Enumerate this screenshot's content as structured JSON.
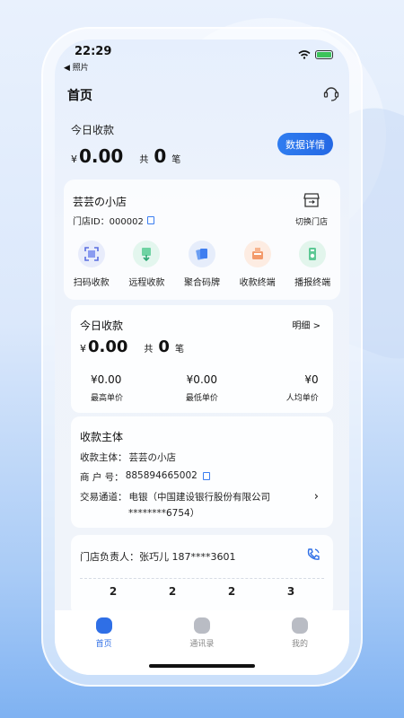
{
  "status_bar": {
    "time": "22:29",
    "back_label": "◀ 照片"
  },
  "nav": {
    "title": "首页"
  },
  "today_summary": {
    "title": "今日收款",
    "currency": "¥",
    "amount": "0.00",
    "count_prefix": "共",
    "count": "0",
    "count_suffix": "笔",
    "detail_button": "数据详情"
  },
  "store": {
    "name": "芸芸の小店",
    "id_label": "门店ID：000002",
    "switch_label": "切换门店"
  },
  "actions": [
    {
      "label": "扫码收款",
      "icon": "scan-icon",
      "color": "#e8ecfb"
    },
    {
      "label": "远程收款",
      "icon": "remote-pay-icon",
      "color": "#e3f6ee"
    },
    {
      "label": "聚合码牌",
      "icon": "qr-card-icon",
      "color": "#e6edfb"
    },
    {
      "label": "收款终端",
      "icon": "pos-terminal-icon",
      "color": "#fdece2"
    },
    {
      "label": "播报终端",
      "icon": "speaker-terminal-icon",
      "color": "#e2f5ec"
    }
  ],
  "today_detail": {
    "title": "今日收款",
    "more": "明细 >",
    "currency": "¥",
    "amount": "0.00",
    "count_prefix": "共",
    "count": "0",
    "count_suffix": "笔",
    "stats": [
      {
        "value": "¥0.00",
        "label": "最高单价"
      },
      {
        "value": "¥0.00",
        "label": "最低单价"
      },
      {
        "value": "¥0",
        "label": "人均单价"
      }
    ]
  },
  "subject": {
    "title": "收款主体",
    "rows": [
      {
        "label": "收款主体：",
        "value": "芸芸の小店"
      },
      {
        "label": "商 户 号：",
        "value": "885894665002"
      },
      {
        "label": "交易通道：",
        "value": "电银（中国建设银行股份有限公司"
      },
      {
        "label": "",
        "value": "********6754）"
      }
    ]
  },
  "contact": {
    "text": "门店负责人：张巧儿 187****3601",
    "numbers": [
      "2",
      "2",
      "2",
      "3"
    ]
  },
  "tabs": [
    {
      "label": "首页",
      "icon": "home-icon",
      "active": true
    },
    {
      "label": "通讯录",
      "icon": "contacts-icon",
      "active": false
    },
    {
      "label": "我的",
      "icon": "profile-icon",
      "active": false
    }
  ],
  "colors": {
    "accent": "#2f6fe6",
    "success": "#3cc35a"
  }
}
